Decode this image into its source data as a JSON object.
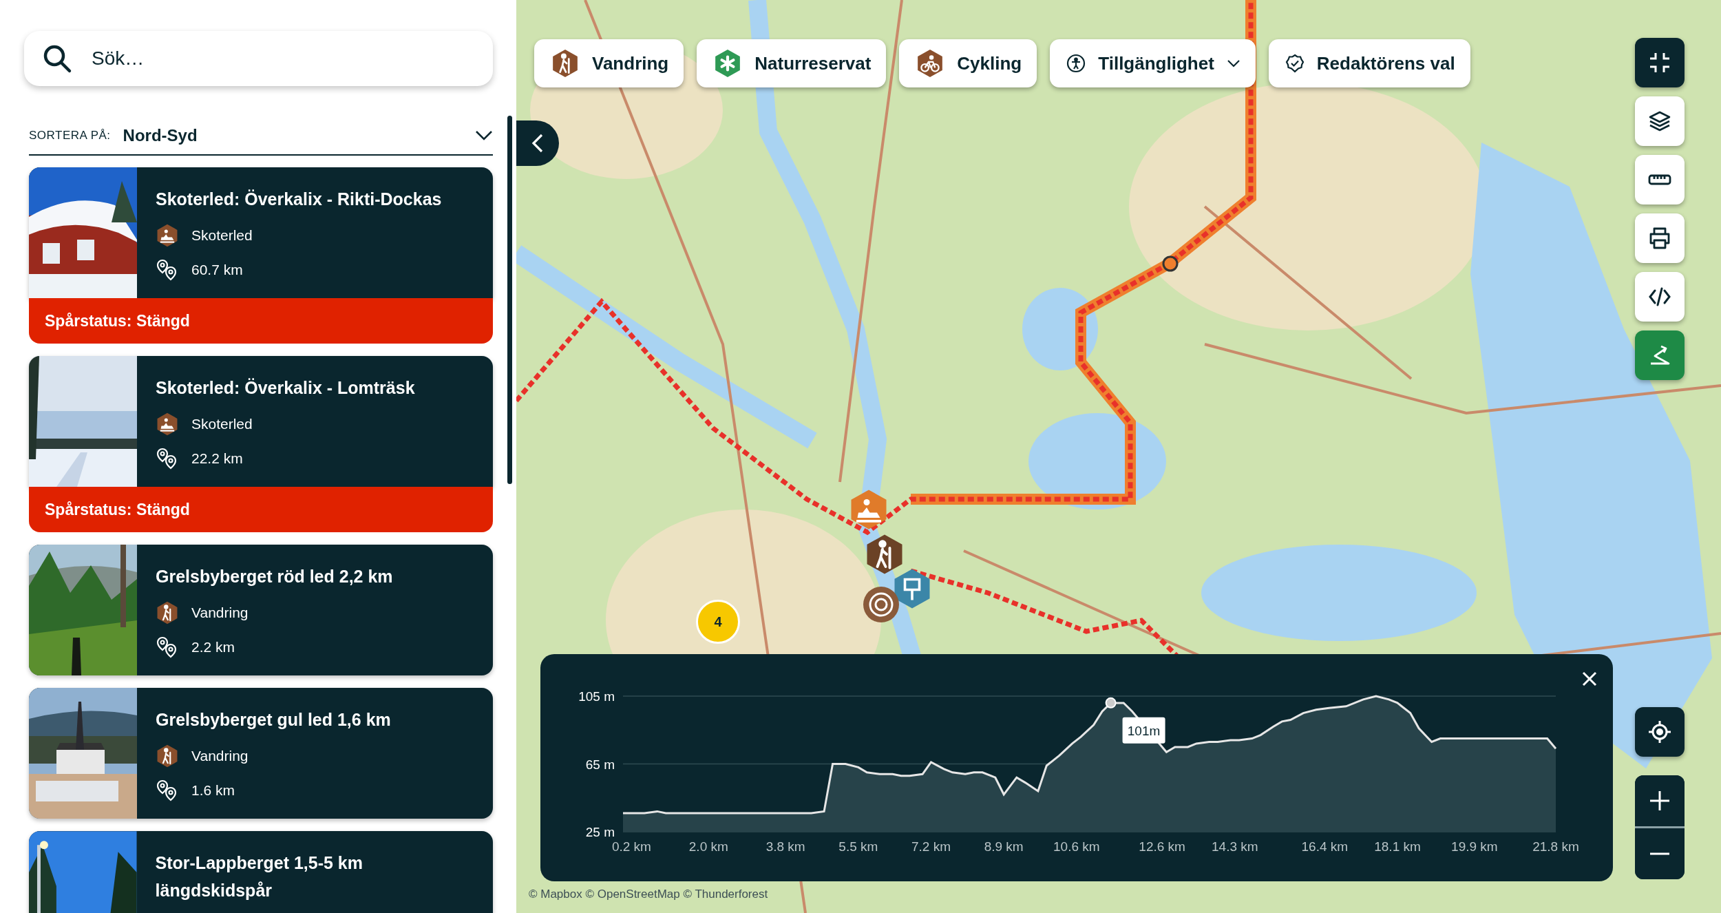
{
  "search": {
    "placeholder": "Sök…"
  },
  "sort": {
    "label": "SORTERA PÅ:",
    "value": "Nord-Syd"
  },
  "trails": [
    {
      "title": "Skoterled: Överkalix - Rikti-Dockas",
      "category": "Skoterled",
      "kind": "snowmobile",
      "distance": "60.7 km",
      "status": "Spårstatus: Stängd"
    },
    {
      "title": "Skoterled: Överkalix - Lomträsk",
      "category": "Skoterled",
      "kind": "snowmobile",
      "distance": "22.2 km",
      "status": "Spårstatus: Stängd"
    },
    {
      "title": "Grelsbyberget röd led 2,2 km",
      "category": "Vandring",
      "kind": "hiking",
      "distance": "2.2 km"
    },
    {
      "title": "Grelsbyberget gul led 1,6 km",
      "category": "Vandring",
      "kind": "hiking",
      "distance": "1.6 km"
    },
    {
      "title": "Stor-Lappberget 1,5-5 km längdskidspår"
    }
  ],
  "filters": [
    {
      "label": "Vandring",
      "kind": "hiking",
      "has_menu": false
    },
    {
      "label": "Naturreservat",
      "kind": "reserve",
      "has_menu": false
    },
    {
      "label": "Cykling",
      "kind": "cycling",
      "has_menu": false
    },
    {
      "label": "Tillgänglighet",
      "kind": "accessibility",
      "has_menu": true
    },
    {
      "label": "Redaktörens val",
      "kind": "editor",
      "has_menu": false
    }
  ],
  "map_tools": [
    {
      "kind": "exit-fullscreen",
      "selected": false
    },
    {
      "kind": "layers",
      "selected": false
    },
    {
      "kind": "measure",
      "selected": false
    },
    {
      "kind": "print",
      "selected": false
    },
    {
      "kind": "embed",
      "selected": false
    },
    {
      "kind": "elevation",
      "selected": true
    }
  ],
  "map_markers": [
    {
      "kind": "snowmobile",
      "color": "#e07b2a"
    },
    {
      "kind": "hiking",
      "color": "#6b4226"
    },
    {
      "kind": "info",
      "color": "#3b86a8"
    },
    {
      "kind": "trail",
      "color": "#8a5a3a"
    }
  ],
  "cluster": {
    "count": "4"
  },
  "elevation_profile": {
    "chart_data": {
      "type": "area",
      "x": [
        0,
        0.5,
        0.8,
        1.0,
        4.4,
        4.7,
        4.9,
        5.2,
        5.5,
        5.7,
        6.0,
        6.3,
        6.5,
        6.7,
        7.0,
        7.2,
        7.5,
        7.7,
        8.0,
        8.2,
        8.4,
        8.7,
        8.9,
        9.2,
        9.4,
        9.7,
        9.9,
        10.2,
        10.5,
        10.7,
        11.0,
        11.2,
        11.4,
        11.7,
        11.9,
        12.7,
        12.9,
        13.2,
        13.4,
        13.7,
        13.9,
        14.2,
        14.4,
        14.7,
        14.9,
        15.2,
        15.4,
        15.6,
        15.9,
        16.2,
        16.5,
        16.9,
        17.3,
        17.6,
        17.9,
        18.1,
        18.4,
        18.6,
        18.9,
        19.1,
        21.6,
        21.8
      ],
      "values": [
        36,
        36,
        37,
        36,
        36,
        37,
        65,
        65,
        63,
        60,
        59,
        59,
        58,
        58,
        59,
        66,
        62,
        60,
        59,
        60,
        60,
        57,
        47,
        57,
        54,
        49,
        64,
        70,
        77,
        81,
        88,
        96,
        101,
        101,
        96,
        72,
        75,
        75,
        77,
        78,
        78,
        79,
        79,
        80,
        82,
        87,
        90,
        91,
        95,
        97,
        98,
        99,
        103,
        105,
        103,
        101,
        95,
        86,
        78,
        80,
        80,
        74
      ],
      "xlim": [
        0,
        21.8
      ],
      "ylim": [
        25,
        105
      ],
      "xticks": [
        {
          "value": 0.2,
          "label": "0.2 km"
        },
        {
          "value": 2.0,
          "label": "2.0 km"
        },
        {
          "value": 3.8,
          "label": "3.8 km"
        },
        {
          "value": 5.5,
          "label": "5.5 km"
        },
        {
          "value": 7.2,
          "label": "7.2 km"
        },
        {
          "value": 8.9,
          "label": "8.9 km"
        },
        {
          "value": 10.6,
          "label": "10.6 km"
        },
        {
          "value": 12.6,
          "label": "12.6 km"
        },
        {
          "value": 14.3,
          "label": "14.3 km"
        },
        {
          "value": 16.4,
          "label": "16.4 km"
        },
        {
          "value": 18.1,
          "label": "18.1 km"
        },
        {
          "value": 19.9,
          "label": "19.9 km"
        },
        {
          "value": 21.8,
          "label": "21.8 km"
        }
      ],
      "yticks": [
        {
          "value": 25,
          "label": "25 m"
        },
        {
          "value": 65,
          "label": "65 m"
        },
        {
          "value": 105,
          "label": "105 m"
        }
      ],
      "annotations": [
        {
          "x": 11.4,
          "y": 101,
          "text": "101m"
        }
      ]
    }
  },
  "attribution": "© Mapbox © OpenStreetMap © Thunderforest"
}
